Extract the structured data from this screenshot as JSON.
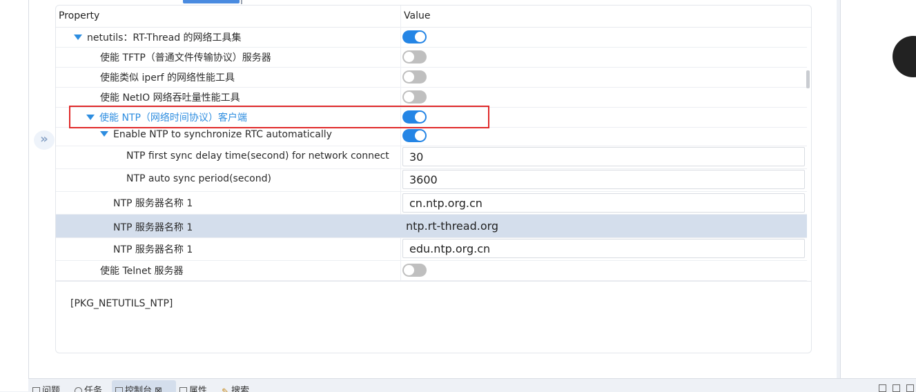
{
  "header": {
    "property_label": "Property",
    "value_label": "Value"
  },
  "rows": [
    {
      "label": "netutils：RT-Thread 的网络工具集",
      "type": "toggle",
      "on": true,
      "expanded": true
    },
    {
      "label": "使能 TFTP（普通文件传输协议）服务器",
      "type": "toggle",
      "on": false
    },
    {
      "label": "使能类似 iperf 的网络性能工具",
      "type": "toggle",
      "on": false
    },
    {
      "label": "使能 NetIO 网络吞吐量性能工具",
      "type": "toggle",
      "on": false
    },
    {
      "label": "使能 NTP（网络时间协议）客户端",
      "type": "toggle",
      "on": true,
      "expanded": true,
      "highlighted": true
    },
    {
      "label": "Enable NTP to synchronize RTC automatically",
      "type": "toggle",
      "on": true,
      "expanded": true
    },
    {
      "label": "NTP first sync delay time(second) for network connect",
      "type": "input",
      "value": "30"
    },
    {
      "label": "NTP auto sync period(second)",
      "type": "input",
      "value": "3600"
    },
    {
      "label": "NTP 服务器名称 1",
      "type": "input",
      "value": "cn.ntp.org.cn"
    },
    {
      "label": "NTP 服务器名称 1",
      "type": "input",
      "value": "ntp.rt-thread.org",
      "selected": true
    },
    {
      "label": "NTP 服务器名称 1",
      "type": "input",
      "value": "edu.ntp.org.cn"
    },
    {
      "label": "使能 Telnet 服务器",
      "type": "toggle",
      "on": false
    }
  ],
  "description": "[PKG_NETUTILS_NTP]",
  "bottom_tabs": [
    {
      "label": "问题",
      "icon": "problems-icon"
    },
    {
      "label": "任务",
      "icon": "tasks-icon"
    },
    {
      "label": "控制台",
      "icon": "console-icon",
      "active": true,
      "suffix": "⊠"
    },
    {
      "label": "属性",
      "icon": "properties-icon"
    },
    {
      "label": "搜索",
      "icon": "search-icon"
    }
  ],
  "colors": {
    "accent": "#2485e5",
    "highlight_box": "#e02828",
    "selected_row": "#d4deec"
  }
}
